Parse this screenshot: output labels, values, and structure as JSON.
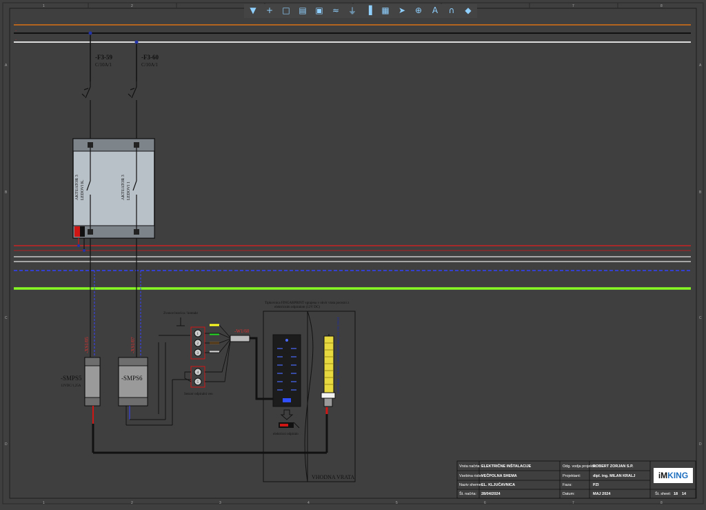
{
  "toolbar": {
    "tools": [
      "filter-icon",
      "crosshair-icon",
      "select-rect-icon",
      "component-icon",
      "terminal-icon",
      "wave-icon",
      "ground-icon",
      "meter-icon",
      "module-icon",
      "arrow-tag-icon",
      "source-icon",
      "text-icon",
      "arc-icon",
      "point-icon"
    ],
    "glyphs": [
      "▼",
      "+",
      "□",
      "▤",
      "▣",
      "≈",
      "⏚",
      "▐",
      "▦",
      "➤",
      "⊕",
      "A",
      "∩",
      "◆"
    ]
  },
  "breakers": [
    {
      "name": "-F3-59",
      "rating": "C/10A/1"
    },
    {
      "name": "-F3-60",
      "rating": "C/10A/1"
    }
  ],
  "actuator": {
    "left_label_1": "AKTUATOR 3",
    "left_label_2": "LEDOVI K.",
    "right_label_1": "AKTUATOR 3",
    "right_label_2": "LEDOVI 1"
  },
  "psu": [
    {
      "name": "-SMPS5",
      "desc": "12VDC/1,25A",
      "tag": "-XS1/05"
    },
    {
      "name": "-SMPS6",
      "desc": "",
      "tag": "-XS1/07"
    }
  ],
  "keys_label": "Zvonce bravica / kontakt",
  "lock_label": "Senzor odpiralni ven",
  "cable_tag": "-W1/60",
  "fingerprint": {
    "title_line1": "Tipkovnica FINGARPRINT vgrajena v okvir vrata pocezni z",
    "title_line2": "elektricnim odpiralom (12V DC)",
    "opener_label": "elektricni odpiralo"
  },
  "door_label": "VHODNA VRATA",
  "door_vertical": "LED TRAK / VRATA / OSVETLITEV ROCAJA VH. VRAT",
  "titleblock": {
    "r1c1_label": "Vrsta načrta:",
    "r1c1_value": "ELEKTRIČNE INŠTALACIJE",
    "r1c2_label": "Odg. vodja projekta:",
    "r1c2_value": "ROBERT ZORJAN S.P.",
    "r2c1_label": "Vsebina risbe:",
    "r2c1_value": "VEČPOLNA SHEMA",
    "r2c2_label": "Projektant:",
    "r2c2_value": "dipl. ing. MILAN KRALJ",
    "r3c1_label": "Naziv sheme:",
    "r3c1_value": "EL. KLJUČAVNICA",
    "r3c2_label": "Faza:",
    "r3c2_value": "PZI",
    "r4c1_label": "Št. načrta:",
    "r4c1_value": "28/04/2024",
    "r4c2_label": "Datum:",
    "r4c2_value": "MAJ 2024",
    "sheet_label": "Št. sheet:",
    "sheet_value": "18",
    "sheet_total": "14",
    "logo_a": "iM",
    "logo_b": "KING"
  },
  "columns": [
    "1",
    "2",
    "3",
    "4",
    "5",
    "6",
    "7",
    "8"
  ],
  "rows": [
    "A",
    "B",
    "C",
    "D"
  ],
  "colors": {
    "bus_brown": "#b5651d",
    "bus_black": "#111111",
    "bus_white": "#dddddd",
    "bus_red": "#cc2222",
    "bus_blue": "#3340ff",
    "bus_green": "#88ff22",
    "wire": "#111111",
    "accent_red": "#d01515",
    "text_red": "#e03030",
    "text_dark": "#111111"
  }
}
